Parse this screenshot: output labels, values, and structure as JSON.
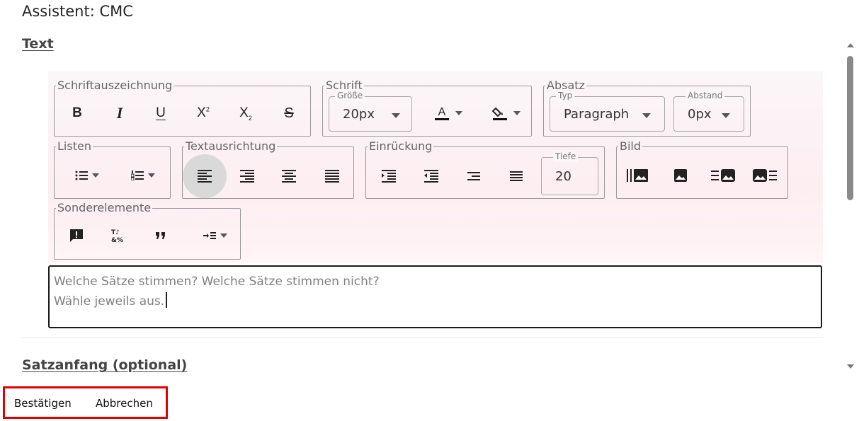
{
  "title": "Assistent: CMC",
  "sections": {
    "text": "Text",
    "sentence_start": "Satzanfang (optional)"
  },
  "toolbar": {
    "groups": {
      "formatting": "Schriftauszeichnung",
      "font": "Schrift",
      "paragraph": "Absatz",
      "lists": "Listen",
      "alignment": "Textausrichtung",
      "indent": "Einrückung",
      "image": "Bild",
      "special": "Sonderelemente"
    },
    "font_size": {
      "label": "Größe",
      "value": "20px"
    },
    "paragraph_type": {
      "label": "Typ",
      "value": "Paragraph"
    },
    "spacing": {
      "label": "Abstand",
      "value": "0px"
    },
    "indent_depth": {
      "label": "Tiefe",
      "value": "20"
    },
    "active_alignment": "left",
    "icons": [
      "bold-icon",
      "italic-icon",
      "underline-icon",
      "superscript-icon",
      "subscript-icon",
      "strikethrough-icon",
      "text-color-icon",
      "fill-color-icon",
      "bullet-list-icon",
      "numbered-list-icon",
      "align-left-icon",
      "align-right-icon",
      "align-center-icon",
      "align-justify-icon",
      "indent-increase-icon",
      "indent-decrease-icon",
      "image-gallery-icon",
      "image-icon",
      "image-right-icon",
      "image-left-icon",
      "alert-icon",
      "special-chars-icon",
      "quote-icon",
      "insert-indent-icon"
    ]
  },
  "editor": {
    "lines": [
      "Welche Sätze stimmen? Welche Sätze stimmen nicht?",
      "Wähle jeweils aus."
    ]
  },
  "actions": {
    "confirm": "Bestätigen",
    "cancel": "Abbrechen"
  },
  "colors": {
    "highlight_border": "#e00000",
    "toolbar_bg": "#fdeef2"
  }
}
